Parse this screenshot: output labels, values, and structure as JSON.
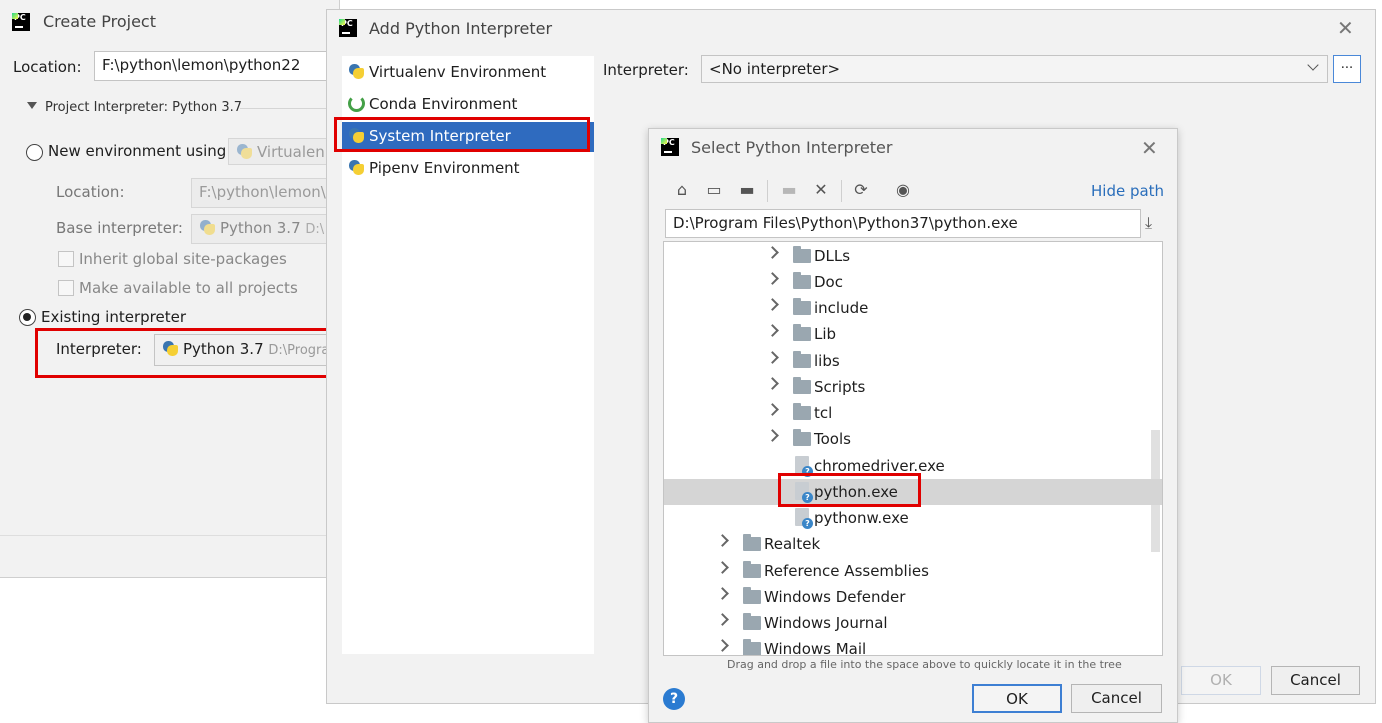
{
  "create_project": {
    "title": "Create Project",
    "location_label": "Location:",
    "location_value": "F:\\python\\lemon\\python22",
    "section_title": "Project Interpreter: Python 3.7",
    "new_env_label": "New environment using",
    "new_env_value": "Virtualen",
    "sub_location_label": "Location:",
    "sub_location_value": "F:\\python\\lemon\\",
    "base_interp_label": "Base interpreter:",
    "base_interp_value": "Python 3.7",
    "base_interp_path": "D:\\",
    "inherit_label": "Inherit global site-packages",
    "make_available_label": "Make available to all projects",
    "existing_label": "Existing interpreter",
    "interp_label": "Interpreter:",
    "interp_value": "Python 3.7",
    "interp_path": "D:\\Progra"
  },
  "add_interpreter": {
    "title": "Add Python Interpreter",
    "envs": [
      {
        "label": "Virtualenv Environment",
        "icon": "virtualenv-icon"
      },
      {
        "label": "Conda Environment",
        "icon": "conda-icon"
      },
      {
        "label": "System Interpreter",
        "icon": "python-icon",
        "selected": true
      },
      {
        "label": "Pipenv Environment",
        "icon": "pipenv-icon"
      }
    ],
    "interpreter_label": "Interpreter:",
    "interpreter_value": "<No interpreter>",
    "browse_label": "...",
    "ok_label": "OK",
    "cancel_label": "Cancel"
  },
  "select_interpreter": {
    "title": "Select Python Interpreter",
    "hide_path_label": "Hide path",
    "path_value": "D:\\Program Files\\Python\\Python37\\python.exe",
    "tree": [
      {
        "label": "DLLs",
        "type": "folder",
        "level": 2
      },
      {
        "label": "Doc",
        "type": "folder",
        "level": 2
      },
      {
        "label": "include",
        "type": "folder",
        "level": 2
      },
      {
        "label": "Lib",
        "type": "folder",
        "level": 2
      },
      {
        "label": "libs",
        "type": "folder",
        "level": 2
      },
      {
        "label": "Scripts",
        "type": "folder",
        "level": 2
      },
      {
        "label": "tcl",
        "type": "folder",
        "level": 2
      },
      {
        "label": "Tools",
        "type": "folder",
        "level": 2
      },
      {
        "label": "chromedriver.exe",
        "type": "file",
        "level": 2
      },
      {
        "label": "python.exe",
        "type": "file",
        "level": 2,
        "selected": true
      },
      {
        "label": "pythonw.exe",
        "type": "file",
        "level": 2
      },
      {
        "label": "Realtek",
        "type": "folder",
        "level": 1
      },
      {
        "label": "Reference Assemblies",
        "type": "folder",
        "level": 1
      },
      {
        "label": "Windows Defender",
        "type": "folder",
        "level": 1
      },
      {
        "label": "Windows Journal",
        "type": "folder",
        "level": 1
      },
      {
        "label": "Windows Mail",
        "type": "folder",
        "level": 1
      }
    ],
    "hint": "Drag and drop a file into the space above to quickly locate it in the tree",
    "ok_label": "OK",
    "cancel_label": "Cancel",
    "help_label": "?"
  },
  "colors": {
    "selection": "#2f6bbf",
    "highlight_box": "#e00000",
    "link": "#2a6ebb"
  }
}
